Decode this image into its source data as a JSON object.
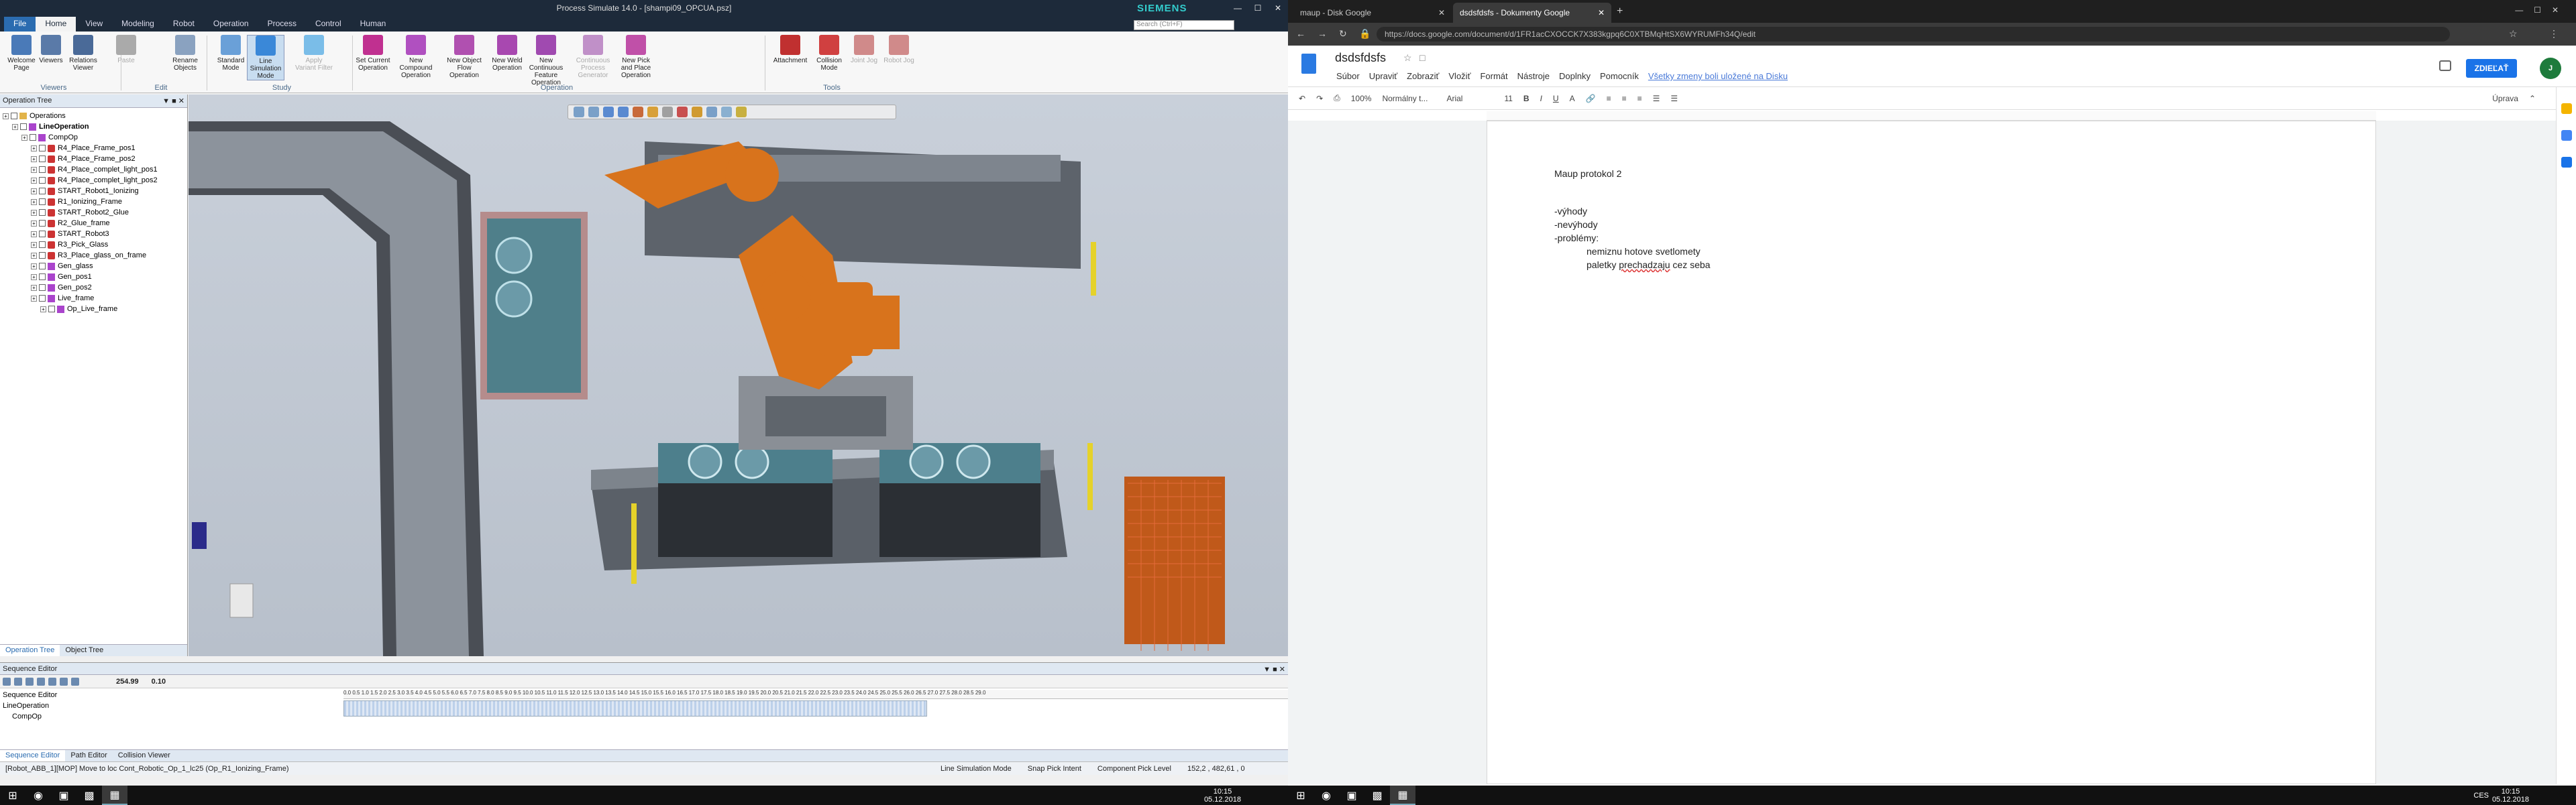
{
  "ps": {
    "title": "Process Simulate 14.0 - [shampi09_OPCUA.psz]",
    "brand": "SIEMENS",
    "menus": [
      "File",
      "Home",
      "View",
      "Modeling",
      "Robot",
      "Operation",
      "Process",
      "Control",
      "Human"
    ],
    "search_placeholder": "Search (Ctrl+F)",
    "ribbon": [
      {
        "label": "Welcome Page",
        "color": "#4a7ab8"
      },
      {
        "label": "Viewers",
        "color": "#5a7aa8"
      },
      {
        "label": "Relations Viewer",
        "color": "#4a6a98"
      },
      {
        "label": "Paste",
        "color": "#aaaaaa",
        "disabled": true
      },
      {
        "label": "Rename Objects",
        "color": "#8aa2c0"
      },
      {
        "label": "Standard Mode",
        "color": "#6aa0d8"
      },
      {
        "label": "Line Simulation Mode",
        "color": "#3a88d8",
        "selected": true
      },
      {
        "label": "Apply Variant Filter",
        "color": "#7abde8",
        "disabled": true
      },
      {
        "label": "Set Current Operation",
        "color": "#c03090"
      },
      {
        "label": "New Compound Operation",
        "color": "#b050c0"
      },
      {
        "label": "New Object Flow Operation",
        "color": "#b050b0"
      },
      {
        "label": "New Weld Operation",
        "color": "#a848b0"
      },
      {
        "label": "New Continuous Feature Operation",
        "color": "#a04ab0"
      },
      {
        "label": "Continuous Process Generator",
        "color": "#c090c8",
        "disabled": true
      },
      {
        "label": "New Pick and Place Operation",
        "color": "#c050a8"
      },
      {
        "label": "Attachment",
        "color": "#c03030"
      },
      {
        "label": "Collision Mode",
        "color": "#d04040"
      },
      {
        "label": "Joint Jog",
        "color": "#d08a8a",
        "disabled": true
      },
      {
        "label": "Robot Jog",
        "color": "#d08a8a",
        "disabled": true
      }
    ],
    "groups": [
      "Viewers",
      "Edit",
      "Study",
      "Operation",
      "Tools"
    ],
    "operation_tree": {
      "title": "Operation Tree",
      "items": [
        {
          "label": "Operations",
          "depth": 0,
          "type": "fold"
        },
        {
          "label": "LineOperation",
          "depth": 1,
          "type": "op",
          "bold": true
        },
        {
          "label": "CompOp",
          "depth": 2,
          "type": "op"
        },
        {
          "label": "R4_Place_Frame_pos1",
          "depth": 3,
          "type": "rob"
        },
        {
          "label": "R4_Place_Frame_pos2",
          "depth": 3,
          "type": "rob"
        },
        {
          "label": "R4_Place_complet_light_pos1",
          "depth": 3,
          "type": "rob"
        },
        {
          "label": "R4_Place_complet_light_pos2",
          "depth": 3,
          "type": "rob"
        },
        {
          "label": "START_Robot1_Ionizing",
          "depth": 3,
          "type": "rob"
        },
        {
          "label": "R1_Ionizing_Frame",
          "depth": 3,
          "type": "rob"
        },
        {
          "label": "START_Robot2_Glue",
          "depth": 3,
          "type": "rob"
        },
        {
          "label": "R2_Glue_frame",
          "depth": 3,
          "type": "rob"
        },
        {
          "label": "START_Robot3",
          "depth": 3,
          "type": "rob"
        },
        {
          "label": "R3_Pick_Glass",
          "depth": 3,
          "type": "rob"
        },
        {
          "label": "R3_Place_glass_on_frame",
          "depth": 3,
          "type": "rob"
        },
        {
          "label": "Gen_glass",
          "depth": 3,
          "type": "op"
        },
        {
          "label": "Gen_pos1",
          "depth": 3,
          "type": "op"
        },
        {
          "label": "Gen_pos2",
          "depth": 3,
          "type": "op"
        },
        {
          "label": "Live_frame",
          "depth": 3,
          "type": "op"
        },
        {
          "label": "Op_Live_frame",
          "depth": 4,
          "type": "op"
        }
      ],
      "tabs": [
        "Operation Tree",
        "Object Tree"
      ]
    },
    "sequence": {
      "title": "Sequence Editor",
      "time": "254.99",
      "step": "0.10",
      "rows": [
        {
          "label": "Sequence Editor",
          "depth": 0
        },
        {
          "label": "LineOperation",
          "depth": 0
        },
        {
          "label": "CompOp",
          "depth": 1
        }
      ],
      "ruler": "0.0  0.5  1.0  1.5  2.0  2.5  3.0  3.5  4.0  4.5  5.0  5.5  6.0  6.5  7.0  7.5  8.0  8.5  9.0  9.5  10.0  10.5  11.0  11.5  12.0  12.5  13.0  13.5  14.0  14.5  15.0  15.5  16.0  16.5  17.0  17.5  18.0  18.5  19.0  19.5  20.0  20.5  21.0  21.5  22.0  22.5  23.0  23.5  24.0  24.5  25.0  25.5  26.0  26.5  27.0  27.5  28.0  28.5  29.0"
    },
    "bottom_tabs": [
      "Sequence Editor",
      "Path Editor",
      "Collision Viewer"
    ],
    "status": {
      "message": "[Robot_ABB_1][MOP] Move to loc Cont_Robotic_Op_1_lc25 (Op_R1_Ionizing_Frame)",
      "mode": "Line Simulation Mode",
      "pick": "Snap Pick Intent",
      "level": "Component Pick Level",
      "coords": "152,2 , 482,61 , 0"
    }
  },
  "chrome": {
    "tabs": [
      {
        "title": "maup - Disk Google",
        "selected": false
      },
      {
        "title": "dsdsfdsfs - Dokumenty Google",
        "selected": true
      }
    ],
    "url": "https://docs.google.com/document/d/1FR1acCXOCCK7X383kgpq6C0XTBMqHtSX6WYRUMFh34Q/edit",
    "doc": {
      "title": "dsdsfdsfs",
      "menus": [
        "Súbor",
        "Upraviť",
        "Zobraziť",
        "Vložiť",
        "Formát",
        "Nástroje",
        "Doplnky",
        "Pomocník"
      ],
      "saved": "Všetky zmeny boli uložené na Disku",
      "share": "ZDIEĽAŤ",
      "avatar": "J",
      "toolbar": {
        "zoom": "100%",
        "style": "Normálny t...",
        "font": "Arial",
        "size": "11",
        "mode": "Úprava"
      },
      "lines": [
        "Maup protokol 2",
        "-výhody",
        "-nevýhody",
        "-problémy:",
        "nemiznu hotove svetlomety",
        "paletky",
        "prechadzaju",
        "cez seba"
      ]
    }
  },
  "taskbar": {
    "left_time": "10:15",
    "left_date": "05.12.2018",
    "right_time": "10:15",
    "right_date": "05.12.2018",
    "lang": "CES"
  }
}
